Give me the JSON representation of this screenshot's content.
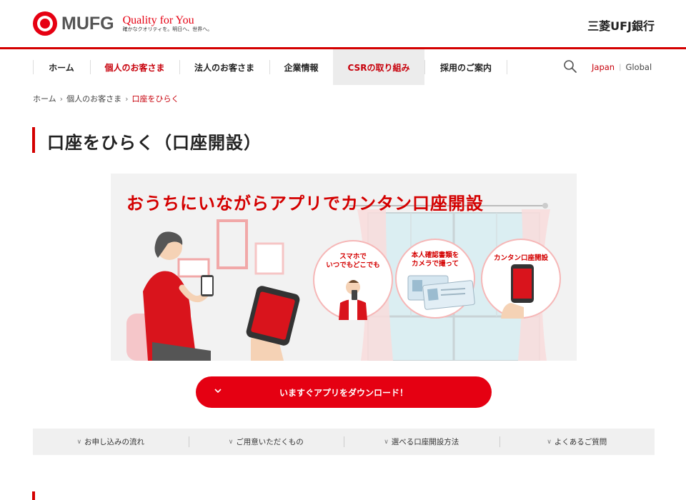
{
  "header": {
    "logo_text": "MUFG",
    "tagline_main": "Quality for You",
    "tagline_sub": "確かなクオリティを。明日へ、世界へ。",
    "bank_name": "三菱UFJ銀行"
  },
  "nav": {
    "items": [
      {
        "label": "ホーム"
      },
      {
        "label": "個人のお客さま"
      },
      {
        "label": "法人のお客さま"
      },
      {
        "label": "企業情報"
      },
      {
        "label": "CSRの取り組み"
      },
      {
        "label": "採用のご案内"
      }
    ],
    "lang_japan": "Japan",
    "lang_sep": "|",
    "lang_global": "Global"
  },
  "breadcrumb": {
    "items": [
      "ホーム",
      "個人のお客さま",
      "口座をひらく"
    ]
  },
  "page": {
    "title": "口座をひらく（口座開設）"
  },
  "banner": {
    "headline": "おうちにいながらアプリでカンタン口座開設",
    "circles": [
      {
        "label_line1": "スマホで",
        "label_line2": "いつでもどこでも"
      },
      {
        "label_line1": "本人確認書類を",
        "label_line2": "カメラで撮って"
      },
      {
        "label_line1": "カンタン口座開設",
        "label_line2": ""
      }
    ]
  },
  "cta": {
    "label": "いますぐアプリをダウンロード！"
  },
  "anchors": [
    {
      "label": "お申し込みの流れ"
    },
    {
      "label": "ご用意いただくもの"
    },
    {
      "label": "選べる口座開設方法"
    },
    {
      "label": "よくあるご質問"
    }
  ],
  "colors": {
    "brand_red": "#e60012",
    "nav_red": "#c7000b"
  }
}
